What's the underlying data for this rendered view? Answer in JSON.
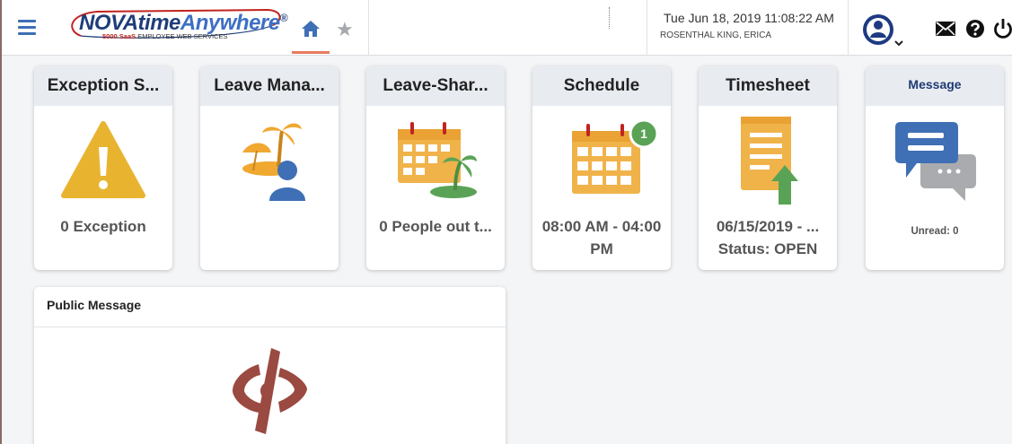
{
  "header": {
    "logo": {
      "brand_main": "NOVAtime",
      "brand_accent": "Anywhere",
      "registered": "®",
      "tagline_red": "5000 SaaS",
      "tagline": "EMPLOYEE WEB SERVICES"
    },
    "datetime": "Tue Jun 18, 2019 11:08:22 AM",
    "username": "ROSENTHAL KING, ERICA",
    "nav": {
      "home_icon": "home-icon",
      "favorites_icon": "star-icon"
    },
    "actions": [
      "user-avatar-icon",
      "mail-icon",
      "help-icon",
      "power-icon"
    ]
  },
  "tiles": [
    {
      "title": "Exception S...",
      "icon": "warning-icon",
      "text": "0 Exception"
    },
    {
      "title": "Leave Mana...",
      "icon": "vacation-person-icon",
      "text": ""
    },
    {
      "title": "Leave-Shar...",
      "icon": "calendar-palm-icon",
      "text": "0 People out t..."
    },
    {
      "title": "Schedule",
      "icon": "calendar-icon",
      "badge": "1",
      "text_line1": "08:00 AM - 04:00",
      "text_line2": "PM"
    },
    {
      "title": "Timesheet",
      "icon": "document-upload-icon",
      "text_line1": "06/15/2019 - ...",
      "text_line2": "Status: OPEN"
    },
    {
      "title": "Message",
      "icon": "chat-bubbles-icon",
      "text": "Unread:  0"
    }
  ],
  "public_message": {
    "title": "Public Message",
    "icon": "hidden-eye-icon"
  },
  "colors": {
    "accent_blue": "#3f6fb5",
    "warning_yellow": "#e8b430",
    "calendar_orange": "#f0b34a",
    "badge_green": "#5aa356",
    "tile_header_bg": "#e8ebf0",
    "eye_red": "#9a4a40"
  }
}
